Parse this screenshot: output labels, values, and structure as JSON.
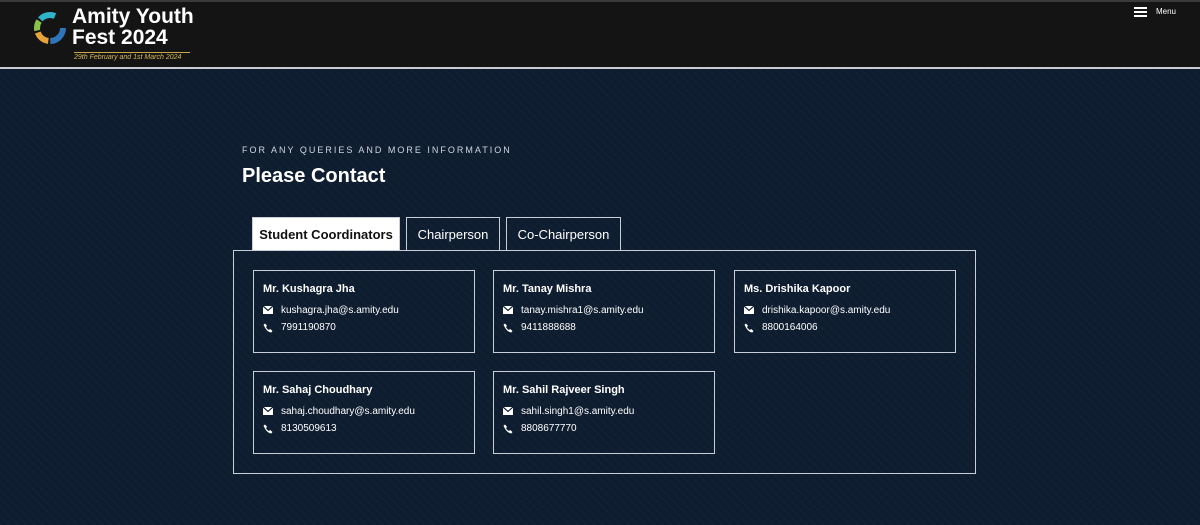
{
  "header": {
    "logo_line1": "Amity Youth",
    "logo_line2": "Fest 2024",
    "logo_date": "29th February and 1st March 2024",
    "menu_label": "Menu"
  },
  "section": {
    "eyebrow": "FOR ANY QUERIES AND MORE INFORMATION",
    "heading": "Please Contact"
  },
  "tabs": [
    {
      "label": "Student Coordinators",
      "active": true
    },
    {
      "label": "Chairperson",
      "active": false
    },
    {
      "label": "Co-Chairperson",
      "active": false
    }
  ],
  "contacts": [
    {
      "name": "Mr. Kushagra Jha",
      "email": "kushagra.jha@s.amity.edu",
      "phone": "7991190870"
    },
    {
      "name": "Mr. Tanay Mishra",
      "email": "tanay.mishra1@s.amity.edu",
      "phone": "9411888688"
    },
    {
      "name": "Ms. Drishika Kapoor",
      "email": "drishika.kapoor@s.amity.edu",
      "phone": "8800164006"
    },
    {
      "name": "Mr. Sahaj Choudhary",
      "email": "sahaj.choudhary@s.amity.edu",
      "phone": "8130509613"
    },
    {
      "name": "Mr. Sahil Rajveer Singh",
      "email": "sahil.singh1@s.amity.edu",
      "phone": "8808677770"
    }
  ],
  "icons": {
    "email": "envelope-icon",
    "phone": "phone-icon",
    "menu": "hamburger-menu-icon",
    "logo": "logo-ring-icon"
  },
  "colors": {
    "background": "#0f1d31",
    "header": "#141414",
    "accent_gold": "#d9b85a",
    "border": "#c9ced6"
  }
}
